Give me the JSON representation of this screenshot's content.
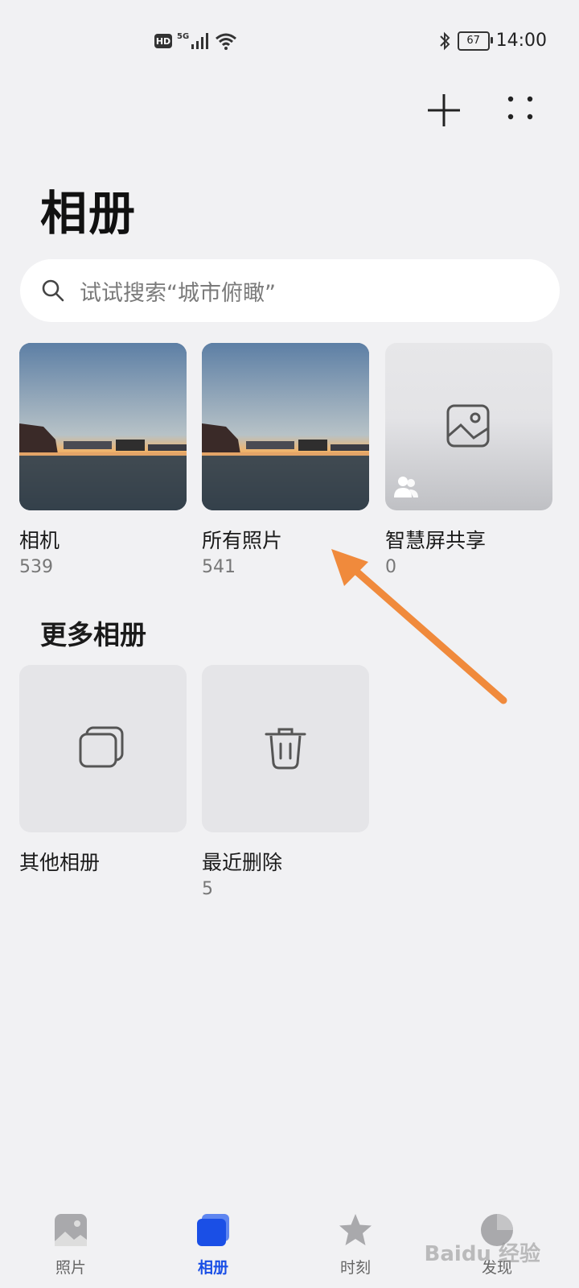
{
  "status_bar": {
    "hd": "HD",
    "signal_type": "5G",
    "battery": "67",
    "time": "14:00"
  },
  "header": {
    "title": "相册"
  },
  "search": {
    "placeholder": "试试搜索“城市俯瞰”"
  },
  "albums": [
    {
      "name": "相机",
      "count": "539",
      "icon": "photo-thumbnail"
    },
    {
      "name": "所有照片",
      "count": "541",
      "icon": "photo-thumbnail"
    },
    {
      "name": "智慧屏共享",
      "count": "0",
      "icon": "image-icon"
    }
  ],
  "more_section": {
    "title": "更多相册",
    "albums": [
      {
        "name": "其他相册",
        "count": "",
        "icon": "stacked-albums-icon"
      },
      {
        "name": "最近删除",
        "count": "5",
        "icon": "trash-icon"
      }
    ]
  },
  "nav": {
    "items": [
      {
        "label": "照片",
        "icon": "photos-icon",
        "active": false
      },
      {
        "label": "相册",
        "icon": "albums-icon",
        "active": true
      },
      {
        "label": "时刻",
        "icon": "star-icon",
        "active": false
      },
      {
        "label": "发现",
        "icon": "discover-icon",
        "active": false
      }
    ]
  },
  "watermark": "Baidu 经验",
  "colors": {
    "accent": "#1a4fe6",
    "annotation_arrow": "#f08a3c",
    "background": "#f1f1f3"
  }
}
